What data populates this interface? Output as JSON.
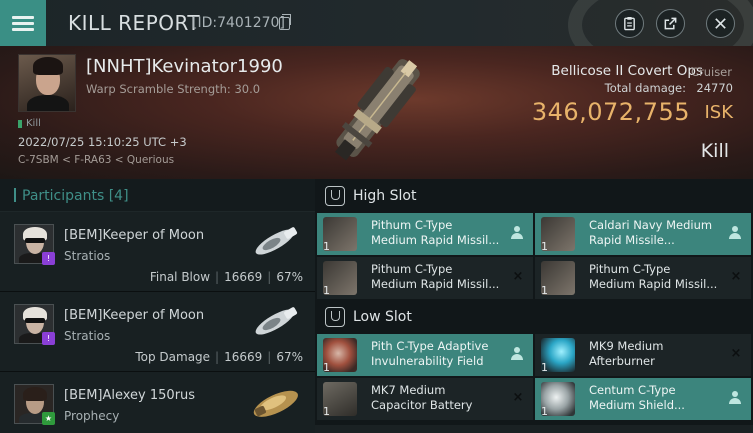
{
  "header": {
    "title": "KILL REPORT",
    "kill_id": "[ID:7401270]"
  },
  "victim": {
    "name": "[NNHT]Kevinator1990",
    "warp_scramble": "Warp Scramble Strength: 30.0",
    "tag": "Kill",
    "datetime": "2022/07/25 15:10:25 UTC +3",
    "location": "C-7SBM < F-RA63 < Querious",
    "ship_name": "Bellicose II Covert Ops",
    "ship_class": "Cruiser",
    "total_damage_label": "Total damage:",
    "total_damage": "24770",
    "isk_value": "346,072,755",
    "isk_unit": "ISK",
    "result": "Kill"
  },
  "participants": {
    "heading": "Participants",
    "count": "[4]",
    "rows": [
      {
        "name": "[BEM]Keeper of Moon",
        "ship": "Stratios",
        "role": "Final Blow",
        "damage": "16669",
        "percent": "67%",
        "badge_color": "#8a3fd6",
        "badge_glyph": "!"
      },
      {
        "name": "[BEM]Keeper of Moon",
        "ship": "Stratios",
        "role": "Top Damage",
        "damage": "16669",
        "percent": "67%",
        "badge_color": "#8a3fd6",
        "badge_glyph": "!"
      },
      {
        "name": "[BEM]Alexey 150rus",
        "ship": "Prophecy",
        "badge_color": "#2f9a3c",
        "badge_glyph": "★"
      }
    ]
  },
  "high_slot": {
    "title": "High Slot",
    "modules": [
      {
        "qty": "1",
        "line1": "Pithum C-Type",
        "line2": "Medium Rapid Missil...",
        "state": "person"
      },
      {
        "qty": "1",
        "line1": "Caldari Navy Medium",
        "line2": "Rapid Missile...",
        "state": "person"
      },
      {
        "qty": "1",
        "line1": "Pithum C-Type",
        "line2": "Medium Rapid Missil...",
        "state": "×"
      },
      {
        "qty": "1",
        "line1": "Pithum C-Type",
        "line2": "Medium Rapid Missil...",
        "state": "×"
      }
    ]
  },
  "low_slot": {
    "title": "Low Slot",
    "modules": [
      {
        "qty": "1",
        "line1": "Pith C-Type Adaptive",
        "line2": "Invulnerability Field",
        "state": "person"
      },
      {
        "qty": "1",
        "line1": "MK9 Medium",
        "line2": "Afterburner",
        "state": "×"
      },
      {
        "qty": "1",
        "line1": "MK7 Medium",
        "line2": "Capacitor Battery",
        "state": "×"
      },
      {
        "qty": "1",
        "line1": "Centum C-Type",
        "line2": "Medium Shield...",
        "state": "person"
      }
    ]
  },
  "colors": {
    "accent_teal": "#3c857d",
    "isk_gold": "#e8b36a"
  }
}
